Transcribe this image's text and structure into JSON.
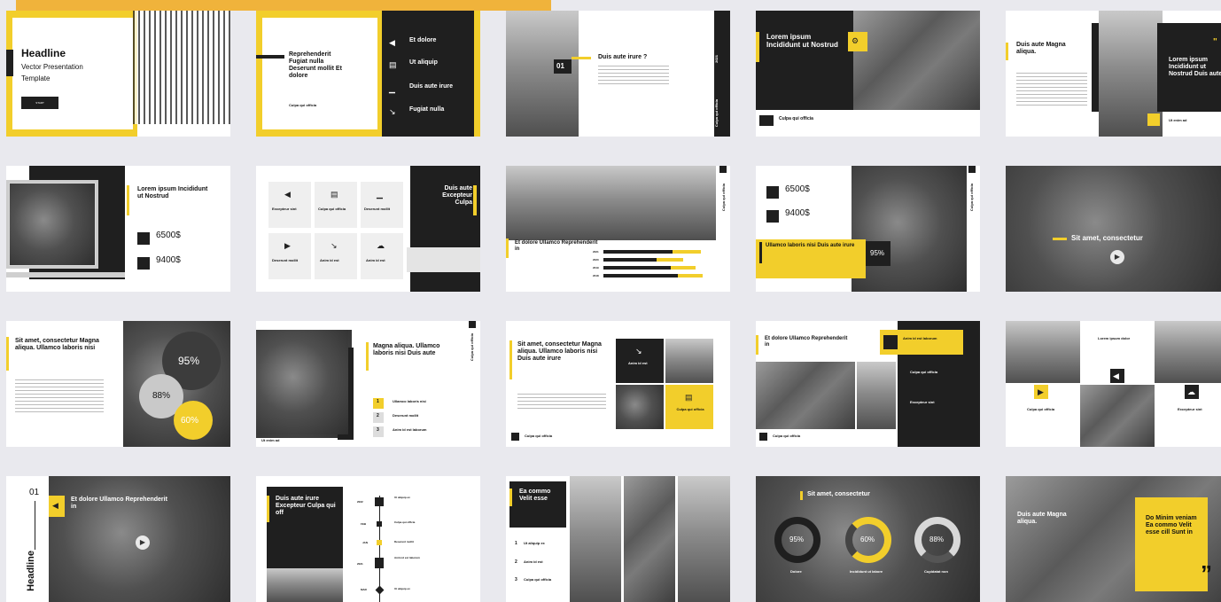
{
  "colors": {
    "accent": "#f2ce2b",
    "dark": "#1f1f1f",
    "background": "#e9e9ee"
  },
  "s1": {
    "title": "Headline",
    "sub1": "Vector Presentation",
    "sub2": "Template",
    "btn": "START"
  },
  "s2": {
    "title": "Reprehenderit Fugiat nulla Deserunt mollit Et dolore",
    "footer": "Culpa qui officia",
    "items": [
      "Et dolore",
      "Ut aliquip",
      "Duis aute irure",
      "Fugiat nulla"
    ]
  },
  "s3": {
    "num": "01",
    "title": "Duis aute irure ?",
    "side": "Culpa qui officia",
    "year": "2021"
  },
  "s4": {
    "title": "Lorem ipsum Incididunt ut Nostrud",
    "footer": "Culpa qui officia"
  },
  "s5": {
    "title": "Duis aute Magna aliqua.",
    "dark_title": "Lorem ipsum Incididunt ut Nostrud Duis aute",
    "quote": "\"",
    "footer": "Ut enim ad"
  },
  "s6": {
    "title": "Lorem ipsum Incididunt ut Nostrud",
    "v1": "6500$",
    "v2": "9400$"
  },
  "s7": {
    "labels": [
      "Excepteur sint",
      "Culpa qui officia",
      "Deserunt mollit",
      "Deserunt mollit",
      "Anim id est",
      "Anim id est"
    ],
    "title": "Duis aute Excepteur Culpa"
  },
  "s8": {
    "title": "Et dolore Ullamco Reprehenderit in",
    "side": "Culpa qui officia",
    "years": [
      "2021",
      "2020",
      "2019",
      "2018"
    ]
  },
  "s9": {
    "v1": "6500$",
    "v2": "9400$",
    "title": "Ullamco laboris nisi Duis aute irure",
    "pct": "95%",
    "side": "Culpa qui officia"
  },
  "s10": {
    "title": "Sit amet, consectetur"
  },
  "s11": {
    "title": "Sit amet, consectetur Magna aliqua. Ullamco laboris nisi",
    "p1": "95%",
    "p2": "88%",
    "p3": "60%"
  },
  "s12": {
    "title": "Magna aliqua. Ullamco laboris nisi Duis aute",
    "side": "Culpa qui officia",
    "footer": "Ut enim ad",
    "items": [
      "Ullamco laboris nisi",
      "Deserunt mollit",
      "Anim id est laborum"
    ],
    "nums": [
      "1",
      "2",
      "3"
    ]
  },
  "s13": {
    "title": "Sit amet, consectetur Magna aliqua. Ullamco laboris nisi Duis aute irure",
    "box1": "Anim id est",
    "box2": "Culpa qui officia",
    "footer": "Culpa qui officia"
  },
  "s14": {
    "title": "Et dolore Ullamco Reprehenderit in",
    "badge": "Anim id est laborum",
    "h1": "Culpa qui officia",
    "h2": "Excepteur sint",
    "footer": "Culpa qui officia"
  },
  "s15": {
    "t1": "Lorem ipsum dolor",
    "t2": "Culpa qui officia",
    "t3": "Excepteur sint"
  },
  "s16": {
    "num": "01",
    "title": "Et dolore Ullamco Reprehenderit in",
    "vertical": "Headline"
  },
  "s17": {
    "title": "Duis aute irure Excepteur Culpa qui off",
    "rows": [
      {
        "y": "2022",
        "t": "Ut aliquip ex"
      },
      {
        "y": "FEB",
        "t": "Culpa qui officia"
      },
      {
        "y": "JAN",
        "t": "Deserunt mollit"
      },
      {
        "y": "2021",
        "t": "Anim id est laborum"
      },
      {
        "y": "MAR",
        "t": "Ut aliquip ex"
      }
    ]
  },
  "s18": {
    "title": "Ea commo Velit esse",
    "items": [
      "Ut aliquip ex",
      "Anim id est",
      "Culpa qui officia"
    ],
    "nums": [
      "1",
      "2",
      "3"
    ]
  },
  "s19": {
    "title": "Sit amet, consectetur",
    "pcts": [
      "95%",
      "60%",
      "88%"
    ],
    "labels": [
      "Dolore",
      "Incididunt ut labore",
      "Cupidatat non"
    ]
  },
  "s20": {
    "title": "Duis aute Magna aliqua.",
    "quote": "Do Minim veniam Ea commo Velit esse cill Sunt in",
    "mark": "”"
  }
}
